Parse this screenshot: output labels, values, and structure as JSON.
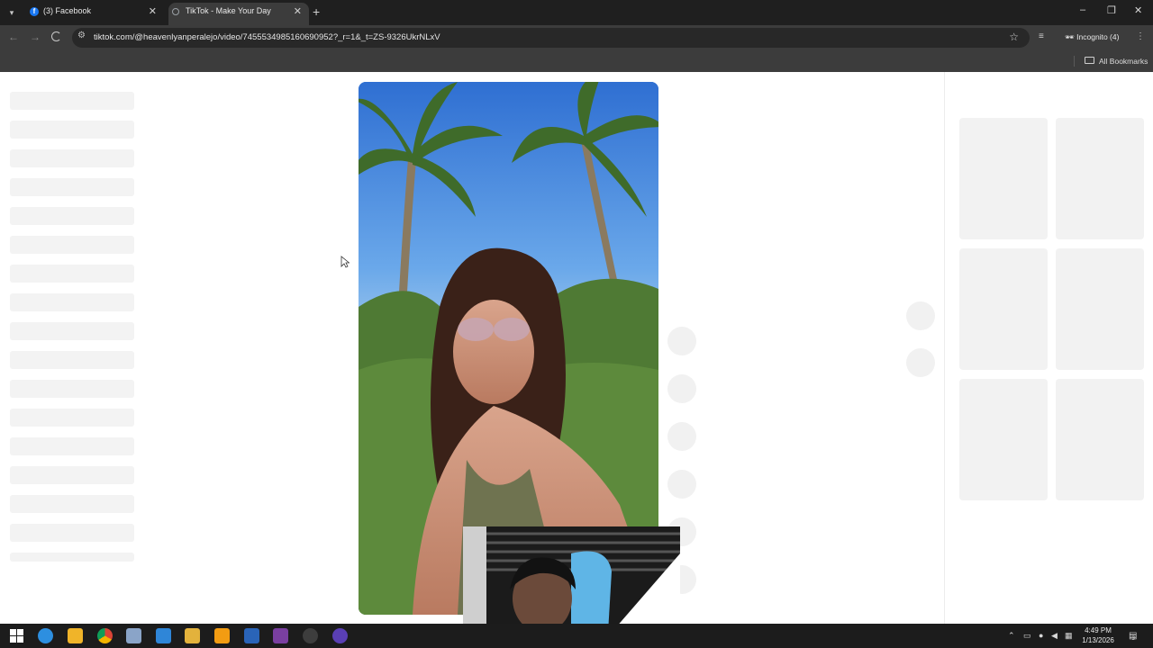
{
  "browser": {
    "tabs": [
      {
        "title": "(3) Facebook",
        "favicon": "facebook-icon",
        "active": false
      },
      {
        "title": "TikTok - Make Your Day",
        "favicon": "tiktok-icon",
        "active": true
      }
    ],
    "url": "tiktok.com/@heavenlyanperalejo/video/7455534985160690952?_r=1&_t=ZS-9326UkrNLxV",
    "profile_label": "Incognito (4)",
    "bookmarks_label": "All Bookmarks"
  },
  "page": {
    "left_skeleton_rows": 17,
    "action_skeleton_circles": 6,
    "right_skeleton_cards": 6
  },
  "taskbar": {
    "apps": [
      "windows-start-icon",
      "edge-icon",
      "copilot-icon",
      "chrome-icon",
      "ai-app-icon",
      "vscode-icon",
      "file-explorer-icon",
      "sublime-icon",
      "photoshop-icon",
      "winrar-icon",
      "clock-app-icon",
      "obs-icon"
    ],
    "time": "4:49 PM",
    "date": "1/13/2026",
    "notification_count": "3"
  },
  "colors": {
    "chrome_dark": "#1f1f1f",
    "chrome_toolbar": "#3c3c3c",
    "skeleton": "#f2f2f2",
    "taskbar": "#1c1c1c"
  }
}
